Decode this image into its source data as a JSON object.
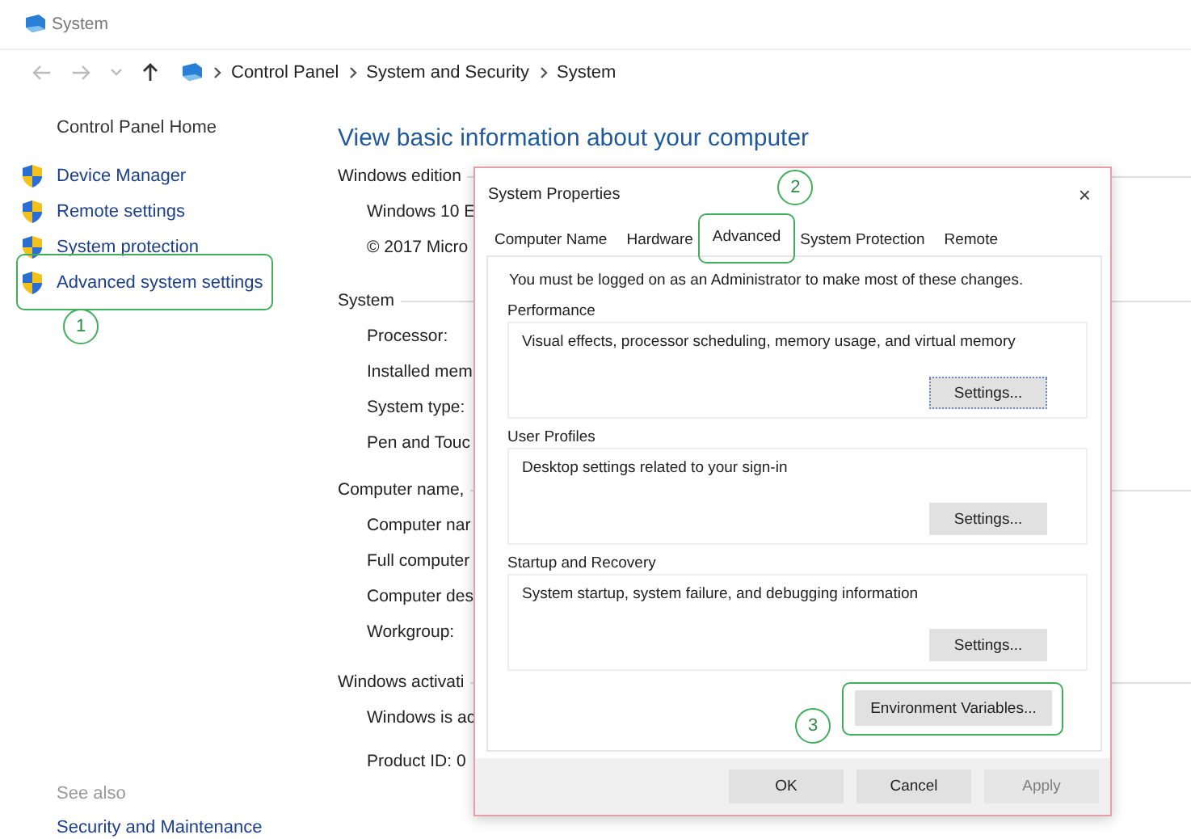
{
  "window": {
    "title": "System"
  },
  "address_bar": {
    "path": [
      "Control Panel",
      "System and Security",
      "System"
    ]
  },
  "sidebar": {
    "home": "Control Panel Home",
    "items": [
      {
        "label": "Device Manager"
      },
      {
        "label": "Remote settings"
      },
      {
        "label": "System protection"
      },
      {
        "label": "Advanced system settings",
        "callout": "1"
      }
    ],
    "see_also": {
      "heading": "See also",
      "links": [
        "Security and Maintenance"
      ]
    }
  },
  "main": {
    "heading": "View basic information about your computer",
    "sections": [
      {
        "heading": "Windows edition",
        "rows": [
          "Windows 10 E",
          "© 2017 Micro"
        ]
      },
      {
        "heading": "System",
        "rows": [
          "Processor:",
          "Installed mem",
          "System type:",
          "Pen and Touc"
        ]
      },
      {
        "heading": "Computer name,",
        "rows": [
          "Computer nar",
          "Full computer",
          "Computer des",
          "Workgroup:"
        ]
      },
      {
        "heading": "Windows activati",
        "rows": [
          "Windows is ac",
          "Product ID: 0"
        ]
      }
    ]
  },
  "dialog": {
    "title": "System Properties",
    "close": "×",
    "tabs": [
      {
        "label": "Computer Name",
        "selected": false
      },
      {
        "label": "Hardware",
        "selected": false
      },
      {
        "label": "Advanced",
        "selected": true,
        "callout": "2"
      },
      {
        "label": "System Protection",
        "selected": false
      },
      {
        "label": "Remote",
        "selected": false
      }
    ],
    "notice": "You must be logged on as an Administrator to make most of these changes.",
    "groups": [
      {
        "label": "Performance",
        "description": "Visual effects, processor scheduling, memory usage, and virtual memory",
        "button": "Settings...",
        "focused": true
      },
      {
        "label": "User Profiles",
        "description": "Desktop settings related to your sign-in",
        "button": "Settings...",
        "focused": false
      },
      {
        "label": "Startup and Recovery",
        "description": "System startup, system failure, and debugging information",
        "button": "Settings...",
        "focused": false
      }
    ],
    "env_button": {
      "label": "Environment Variables...",
      "callout": "3"
    },
    "footer_buttons": [
      {
        "label": "OK",
        "disabled": false
      },
      {
        "label": "Cancel",
        "disabled": false
      },
      {
        "label": "Apply",
        "disabled": true
      }
    ]
  }
}
